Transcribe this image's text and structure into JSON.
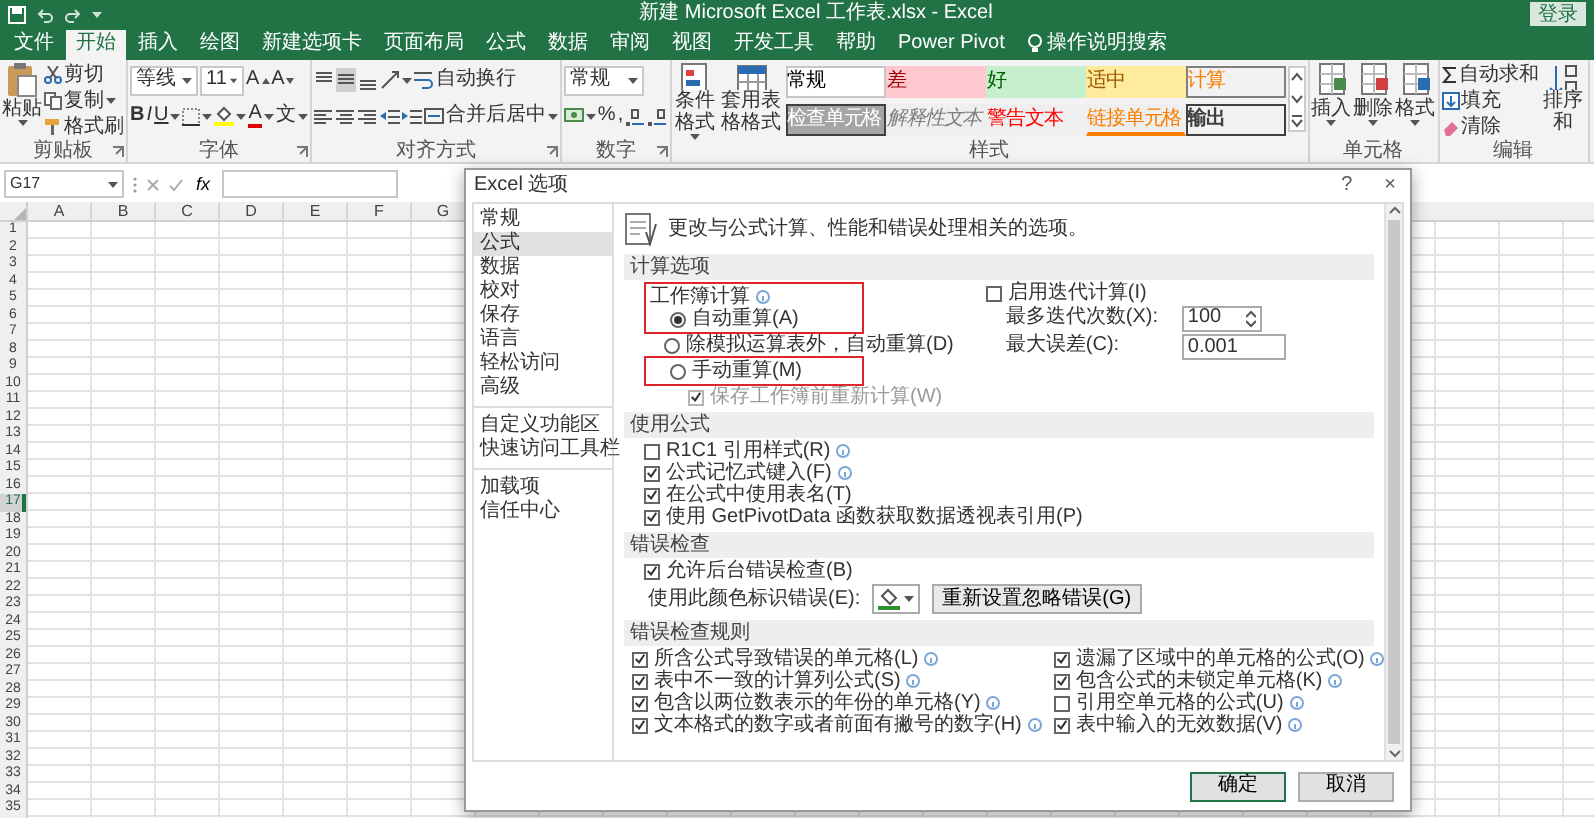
{
  "title_bar": {
    "title": "新建 Microsoft Excel 工作表.xlsx - Excel",
    "sign_in": "登录"
  },
  "tabs": [
    {
      "label": "文件",
      "selected": false
    },
    {
      "label": "开始",
      "selected": true
    },
    {
      "label": "插入",
      "selected": false
    },
    {
      "label": "绘图",
      "selected": false
    },
    {
      "label": "新建选项卡",
      "selected": false
    },
    {
      "label": "页面布局",
      "selected": false
    },
    {
      "label": "公式",
      "selected": false
    },
    {
      "label": "数据",
      "selected": false
    },
    {
      "label": "审阅",
      "selected": false
    },
    {
      "label": "视图",
      "selected": false
    },
    {
      "label": "开发工具",
      "selected": false
    },
    {
      "label": "帮助",
      "selected": false
    },
    {
      "label": "Power Pivot",
      "selected": false
    }
  ],
  "tell_me": "操作说明搜索",
  "ribbon": {
    "clipboard": {
      "label": "剪贴板",
      "paste": "粘贴",
      "cut": "剪切",
      "copy": "复制",
      "format_painter": "格式刷"
    },
    "font": {
      "label": "字体",
      "font_name": "等线",
      "font_size": "11",
      "increase": "A",
      "decrease": "A",
      "bold": "B",
      "italic": "I",
      "underline": "U",
      "font_color": "A",
      "phonetic": "文"
    },
    "alignment": {
      "label": "对齐方式",
      "wrap_text": "自动换行",
      "merge_center": "合并后居中"
    },
    "number": {
      "label": "数字",
      "format": "常规",
      "percent": "%",
      "comma": ","
    },
    "styles": {
      "label": "样式",
      "conditional_formatting": "条件格式",
      "format_as_table": "套用表格格式",
      "gallery": [
        {
          "label": "常规",
          "kind": "normal"
        },
        {
          "label": "差",
          "kind": "bad"
        },
        {
          "label": "好",
          "kind": "good"
        },
        {
          "label": "适中",
          "kind": "neutral"
        },
        {
          "label": "计算",
          "kind": "calculation"
        },
        {
          "label": "检查单元格",
          "kind": "check"
        },
        {
          "label": "解释性文本",
          "kind": "explanatory"
        },
        {
          "label": "警告文本",
          "kind": "warning"
        },
        {
          "label": "链接单元格",
          "kind": "linked"
        },
        {
          "label": "输出",
          "kind": "output"
        }
      ]
    },
    "cells": {
      "label": "单元格",
      "insert": "插入",
      "delete": "删除",
      "format": "格式"
    },
    "editing": {
      "label": "编辑",
      "autosum": "自动求和",
      "fill": "填充",
      "clear": "清除",
      "sort_filter": "排序和"
    }
  },
  "formula_bar": {
    "name_box": "G17",
    "function_label": "fx"
  },
  "sheet": {
    "columns": [
      "A",
      "B",
      "C",
      "D",
      "E",
      "F",
      "G"
    ],
    "rows": [
      {
        "label": "1",
        "selected": false
      },
      {
        "label": "2",
        "selected": false
      },
      {
        "label": "3",
        "selected": false
      },
      {
        "label": "4",
        "selected": false
      },
      {
        "label": "5",
        "selected": false
      },
      {
        "label": "6",
        "selected": false
      },
      {
        "label": "7",
        "selected": false
      },
      {
        "label": "8",
        "selected": false
      },
      {
        "label": "9",
        "selected": false
      },
      {
        "label": "10",
        "selected": false
      },
      {
        "label": "11",
        "selected": false
      },
      {
        "label": "12",
        "selected": false
      },
      {
        "label": "13",
        "selected": false
      },
      {
        "label": "14",
        "selected": false
      },
      {
        "label": "15",
        "selected": false
      },
      {
        "label": "16",
        "selected": false
      },
      {
        "label": "17",
        "selected": true
      },
      {
        "label": "18",
        "selected": false
      },
      {
        "label": "19",
        "selected": false
      },
      {
        "label": "20",
        "selected": false
      },
      {
        "label": "21",
        "selected": false
      },
      {
        "label": "22",
        "selected": false
      },
      {
        "label": "23",
        "selected": false
      },
      {
        "label": "24",
        "selected": false
      },
      {
        "label": "25",
        "selected": false
      },
      {
        "label": "26",
        "selected": false
      },
      {
        "label": "27",
        "selected": false
      },
      {
        "label": "28",
        "selected": false
      },
      {
        "label": "29",
        "selected": false
      },
      {
        "label": "30",
        "selected": false
      },
      {
        "label": "31",
        "selected": false
      },
      {
        "label": "32",
        "selected": false
      },
      {
        "label": "33",
        "selected": false
      },
      {
        "label": "34",
        "selected": false
      },
      {
        "label": "35",
        "selected": false
      }
    ]
  },
  "dialog": {
    "title": "Excel 选项",
    "help": "?",
    "close": "×",
    "nav_groups": [
      [
        {
          "label": "常规",
          "selected": false
        },
        {
          "label": "公式",
          "selected": true
        },
        {
          "label": "数据",
          "selected": false
        },
        {
          "label": "校对",
          "selected": false
        },
        {
          "label": "保存",
          "selected": false
        },
        {
          "label": "语言",
          "selected": false
        },
        {
          "label": "轻松访问",
          "selected": false
        },
        {
          "label": "高级",
          "selected": false
        }
      ],
      [
        {
          "label": "自定义功能区",
          "selected": false
        },
        {
          "label": "快速访问工具栏",
          "selected": false
        }
      ],
      [
        {
          "label": "加载项",
          "selected": false
        },
        {
          "label": "信任中心",
          "selected": false
        }
      ]
    ],
    "header": "更改与公式计算、性能和错误处理相关的选项。",
    "sections": [
      {
        "kind": "calculation",
        "title": "计算选项",
        "workbook_calculation": "工作簿计算",
        "info": true,
        "modes": [
          {
            "label": "自动重算(A)",
            "selected": true,
            "outlined": true
          },
          {
            "label": "除模拟运算表外，自动重算(D)",
            "selected": false,
            "outlined": false
          },
          {
            "label": "手动重算(M)",
            "selected": false,
            "outlined": true
          }
        ],
        "recalc_before_save": {
          "label": "保存工作簿前重新计算(W)",
          "checked": true,
          "disabled": true
        },
        "iterative": {
          "label": "启用迭代计算(I)",
          "checked": false
        },
        "max_iterations": {
          "label": "最多迭代次数(X):",
          "value": "100"
        },
        "max_change": {
          "label": "最大误差(C):",
          "value": "0.001"
        }
      },
      {
        "kind": "checklist",
        "title": "使用公式",
        "items": [
          {
            "label": "R1C1 引用样式(R)",
            "checked": false,
            "info": true
          },
          {
            "label": "公式记忆式键入(F)",
            "checked": true,
            "info": true
          },
          {
            "label": "在公式中使用表名(T)",
            "checked": true,
            "info": false
          },
          {
            "label": "使用 GetPivotData 函数获取数据透视表引用(P)",
            "checked": true,
            "info": false
          }
        ]
      },
      {
        "kind": "error_checking",
        "title": "错误检查",
        "background": {
          "label": "允许后台错误检查(B)",
          "checked": true
        },
        "color_label": "使用此颜色标识错误(E):",
        "reset_button": "重新设置忽略错误(G)"
      },
      {
        "kind": "rules",
        "title": "错误检查规则",
        "items": [
          {
            "label": "所含公式导致错误的单元格(L)",
            "checked": true,
            "info": true
          },
          {
            "label": "遗漏了区域中的单元格的公式(O)",
            "checked": true,
            "info": true
          },
          {
            "label": "表中不一致的计算列公式(S)",
            "checked": true,
            "info": true
          },
          {
            "label": "包含公式的未锁定单元格(K)",
            "checked": true,
            "info": true
          },
          {
            "label": "包含以两位数表示的年份的单元格(Y)",
            "checked": true,
            "info": true
          },
          {
            "label": "引用空单元格的公式(U)",
            "checked": false,
            "info": true
          },
          {
            "label": "文本格式的数字或者前面有撇号的数字(H)",
            "checked": true,
            "info": true
          },
          {
            "label": "表中输入的无效数据(V)",
            "checked": true,
            "info": true
          }
        ]
      }
    ],
    "buttons": [
      {
        "label": "确定",
        "default": true
      },
      {
        "label": "取消",
        "default": false
      }
    ]
  }
}
